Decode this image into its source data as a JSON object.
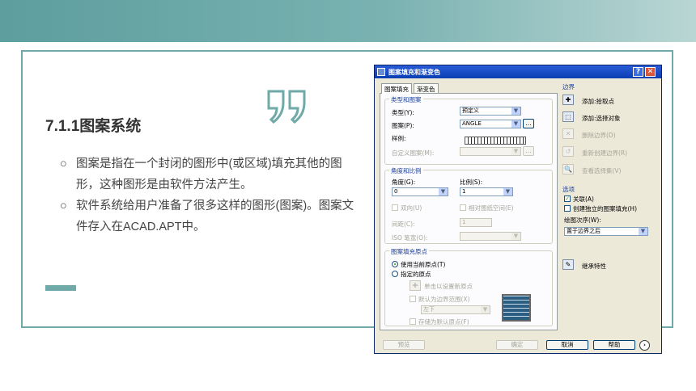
{
  "slide": {
    "title": "7.1.1图案系统",
    "quote_mark": "99",
    "bullet_marker": "○",
    "bullets": [
      "图案是指在一个封闭的图形中(或区域)填充其他的图形，这种图形是由软件方法产生。",
      "软件系统给用户准备了很多这样的图形(图案)。图案文件存入在ACAD.APT中。"
    ]
  },
  "dialog": {
    "title": "图案填充和渐变色",
    "help_btn": "?",
    "close_btn": "✕",
    "tabs": [
      "图案填充",
      "渐变色"
    ],
    "type_group": {
      "label": "类型和图案",
      "type_label": "类型(Y):",
      "type_value": "预定义",
      "pattern_label": "图案(P):",
      "pattern_value": "ANGLE",
      "more_btn": "...",
      "sample_label": "样例:",
      "custom_label": "自定义图案(M):",
      "custom_btn": "..."
    },
    "angle_group": {
      "label": "角度和比例",
      "angle_label": "角度(G):",
      "angle_value": "0",
      "scale_label": "比例(S):",
      "scale_value": "1",
      "double_label": "双向(U)",
      "relative_label": "相对图纸空间(E)",
      "spacing_label": "间距(C):",
      "spacing_value": "1",
      "iso_label": "ISO 笔宽(O):"
    },
    "origin_group": {
      "label": "图案填充原点",
      "use_current": "使用当前原点(T)",
      "specified": "指定的原点",
      "click_set": "单击以设置新原点",
      "default_extent": "默认为边界范围(X)",
      "position_value": "左下",
      "store_default": "存储为默认原点(F)"
    },
    "boundary": {
      "label": "边界",
      "add_pick": "添加:拾取点",
      "add_select": "添加:选择对象",
      "remove": "删除边界(D)",
      "recreate": "重新创建边界(R)",
      "view_select": "查看选择集(V)"
    },
    "options": {
      "label": "选项",
      "associative": "关联(A)",
      "separate": "创建独立的图案填充(H)",
      "draw_order_label": "绘图次序(W):",
      "draw_order_value": "置于边界之后"
    },
    "inherit": "继承特性",
    "footer": {
      "preview": "预览",
      "ok": "确定",
      "cancel": "取消",
      "help": "帮助",
      "more": "›"
    }
  }
}
